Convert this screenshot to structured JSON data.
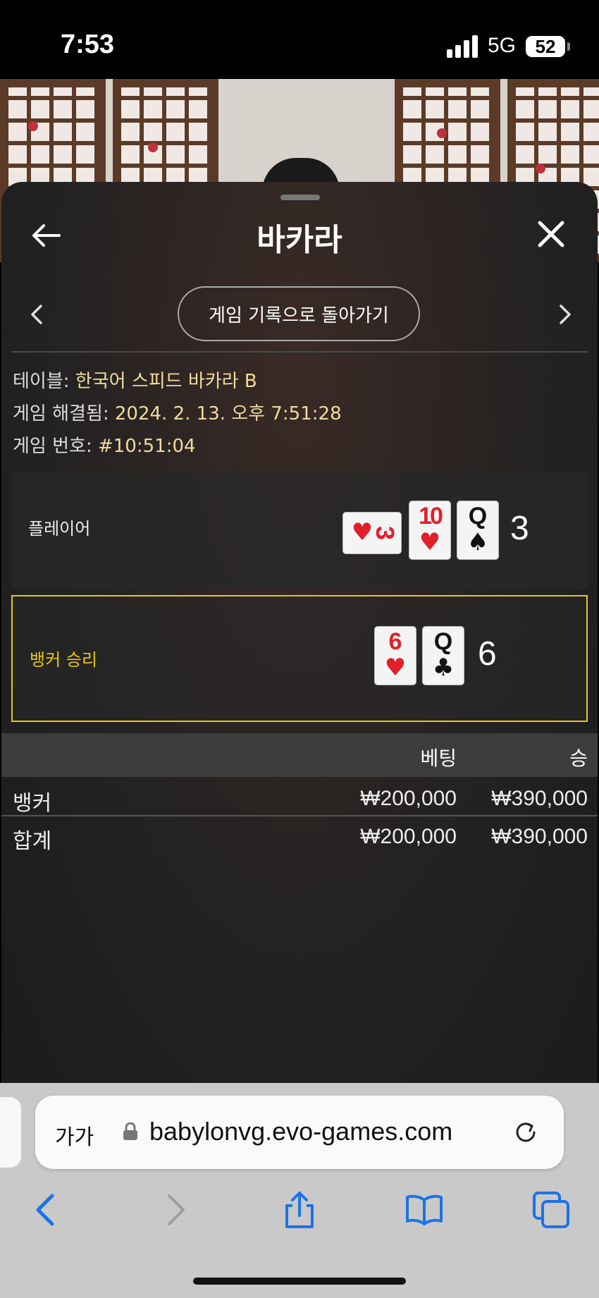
{
  "status_bar": {
    "time": "7:53",
    "network": "5G",
    "battery": "52"
  },
  "header": {
    "title": "바카라"
  },
  "history_button": {
    "label": "게임 기록으로 돌아가기"
  },
  "info": {
    "table_label": "테이블:",
    "table_value": "한국어 스피드 바카라 B",
    "resolved_label": "게임 해결됨:",
    "resolved_value": "2024. 2. 13. 오후 7:51:28",
    "number_label": "게임 번호:",
    "number_value": "#10:51:04"
  },
  "player": {
    "label": "플레이어",
    "score": "3",
    "cards": [
      {
        "rank": "3",
        "suit": "♥",
        "color": "red",
        "rotated": true
      },
      {
        "rank": "10",
        "suit": "♥",
        "color": "red",
        "rotated": false
      },
      {
        "rank": "Q",
        "suit": "♠",
        "color": "black",
        "rotated": false
      }
    ]
  },
  "banker": {
    "label": "뱅커 승리",
    "score": "6",
    "cards": [
      {
        "rank": "6",
        "suit": "♥",
        "color": "red"
      },
      {
        "rank": "Q",
        "suit": "♣",
        "color": "black"
      }
    ]
  },
  "bets_table": {
    "columns": [
      "베팅",
      "승"
    ],
    "rows": [
      {
        "name": "뱅커",
        "bet": "₩200,000",
        "win": "₩390,000"
      },
      {
        "name": "합계",
        "bet": "₩200,000",
        "win": "₩390,000"
      }
    ]
  },
  "browser": {
    "text_size_label": "가가",
    "url": "babylonvg.evo-games.com"
  },
  "colors": {
    "accent_yellow": "#e8c61a",
    "info_value": "#f0dca0",
    "ios_blue": "#1a73e8"
  }
}
